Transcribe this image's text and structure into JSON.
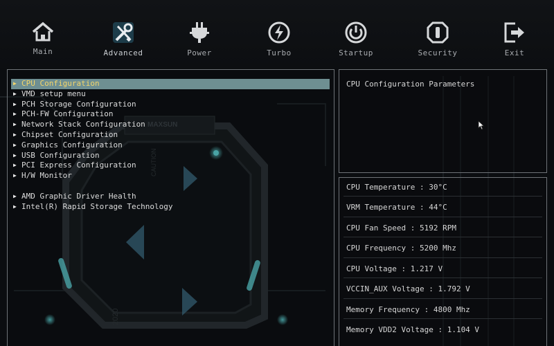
{
  "nav": [
    {
      "label": "Main",
      "icon": "home-icon"
    },
    {
      "label": "Advanced",
      "icon": "tools-icon"
    },
    {
      "label": "Power",
      "icon": "power-plug-icon"
    },
    {
      "label": "Turbo",
      "icon": "turbo-icon"
    },
    {
      "label": "Startup",
      "icon": "startup-power-icon"
    },
    {
      "label": "Security",
      "icon": "security-icon"
    },
    {
      "label": "Exit",
      "icon": "exit-icon"
    }
  ],
  "active_tab": "Advanced",
  "menu": {
    "selected": "CPU Configuration",
    "items": [
      "CPU Configuration",
      "VMD setup menu",
      "PCH Storage Configuration",
      "PCH-FW Configuration",
      "Network Stack Configuration",
      "Chipset Configuration",
      "Graphics Configuration",
      "USB Configuration",
      "PCI Express Configuration",
      "H/W Monitor"
    ],
    "items_group2": [
      "AMD Graphic Driver Health",
      "Intel(R) Rapid Storage Technology"
    ]
  },
  "help": {
    "text": "CPU Configuration Parameters"
  },
  "monitor": [
    "CPU Temperature : 30°C",
    "VRM Temperature : 44°C",
    "CPU Fan Speed : 5192 RPM",
    "CPU Frequency : 5200 Mhz",
    "CPU Voltage : 1.217 V",
    "VCCIN_AUX Voltage : 1.792 V",
    "Memory Frequency : 4800 Mhz",
    "Memory VDD2 Voltage : 1.104 V"
  ],
  "background_art": {
    "brand": "MAXSUN",
    "side_text": "CAUTION",
    "year_text": "2020"
  },
  "colors": {
    "selection_bg": "#6e8f92",
    "selection_text": "#f4d66a",
    "accent": "#5fd6d9",
    "panel_border": "#6f7378"
  }
}
